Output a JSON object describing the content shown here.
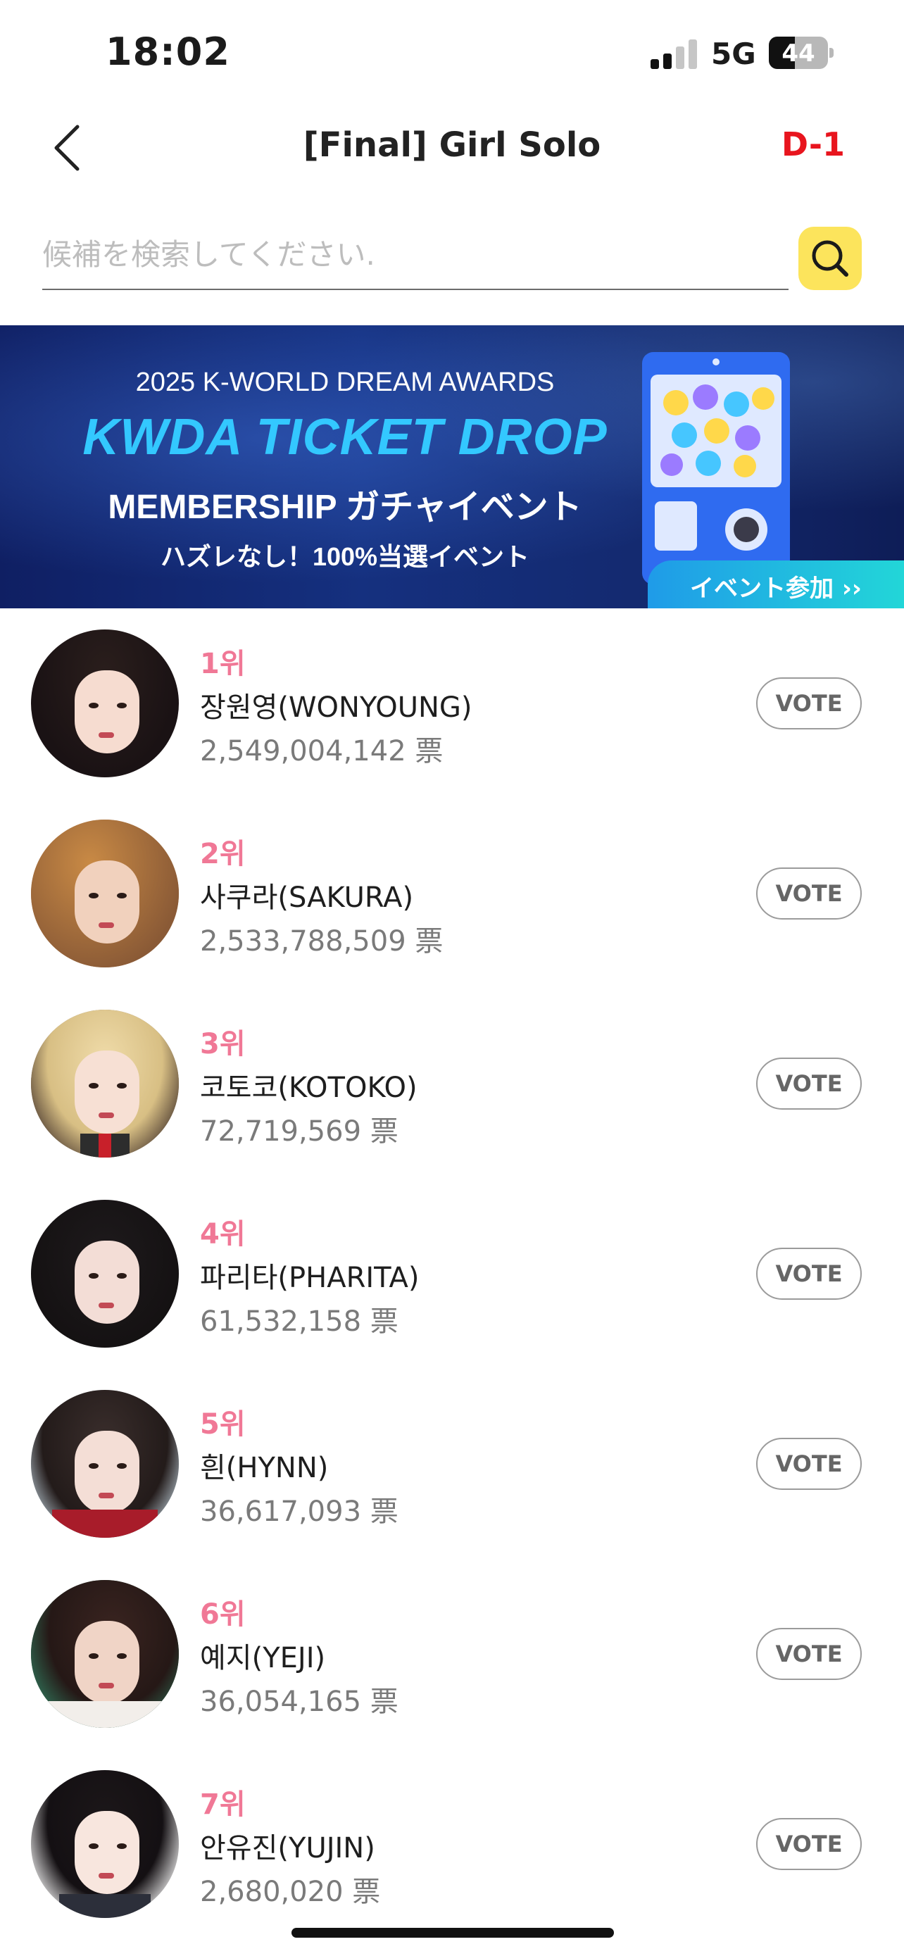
{
  "status_bar": {
    "time": "18:02",
    "network": "5G",
    "battery_level": "44",
    "battery_fraction": 0.44,
    "signal_bars_active": 2,
    "signal_bars_total": 4
  },
  "header": {
    "title": "[Final] Girl Solo",
    "dday": "D-1",
    "back_icon": "chevron-left-icon"
  },
  "search": {
    "placeholder": "候補を検索してください.",
    "value": "",
    "icon": "search-icon",
    "button_color": "#fce45c"
  },
  "banner": {
    "line1": "2025 K-WORLD DREAM AWARDS",
    "line2": "KWDA TICKET DROP",
    "line3": "MEMBERSHIP ガチャイベント",
    "line4": "ハズレなし！100%当選イベント",
    "cta": "イベント参加 ››"
  },
  "colors": {
    "rank": "#f07896",
    "dday": "#e8151e",
    "accent_yellow": "#fce45c"
  },
  "candidates": [
    {
      "rank": "1위",
      "name": "장원영(WONYOUNG)",
      "votes": "2,549,004,142 票",
      "button": "VOTE"
    },
    {
      "rank": "2위",
      "name": "사쿠라(SAKURA)",
      "votes": "2,533,788,509 票",
      "button": "VOTE"
    },
    {
      "rank": "3위",
      "name": "코토코(KOTOKO)",
      "votes": "72,719,569 票",
      "button": "VOTE"
    },
    {
      "rank": "4위",
      "name": "파리타(PHARITA)",
      "votes": "61,532,158 票",
      "button": "VOTE"
    },
    {
      "rank": "5위",
      "name": "흰(HYNN)",
      "votes": "36,617,093 票",
      "button": "VOTE"
    },
    {
      "rank": "6위",
      "name": "예지(YEJI)",
      "votes": "36,054,165 票",
      "button": "VOTE"
    },
    {
      "rank": "7위",
      "name": "안유진(YUJIN)",
      "votes": "2,680,020 票",
      "button": "VOTE"
    }
  ]
}
